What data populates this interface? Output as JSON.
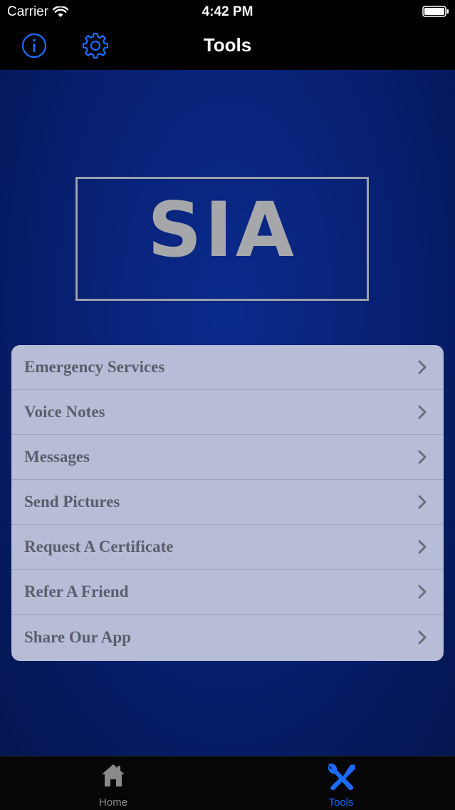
{
  "status_bar": {
    "carrier": "Carrier",
    "time": "4:42 PM"
  },
  "nav": {
    "title": "Tools",
    "left_icons": [
      "info-icon",
      "gear-icon"
    ]
  },
  "logo": {
    "text": "SIA"
  },
  "menu": {
    "items": [
      {
        "label": "Emergency Services"
      },
      {
        "label": "Voice Notes"
      },
      {
        "label": "Messages"
      },
      {
        "label": "Send Pictures"
      },
      {
        "label": "Request A Certificate"
      },
      {
        "label": "Refer A Friend"
      },
      {
        "label": "Share Our App"
      }
    ]
  },
  "tab_bar": {
    "tabs": [
      {
        "label": "Home",
        "icon": "home-icon",
        "selected": false
      },
      {
        "label": "Tools",
        "icon": "tools-icon",
        "selected": true
      }
    ]
  },
  "colors": {
    "accent": "#1a6bff",
    "background": "#082278",
    "menu_card": "#b7bdd7",
    "menu_text": "#5b5e6c"
  }
}
